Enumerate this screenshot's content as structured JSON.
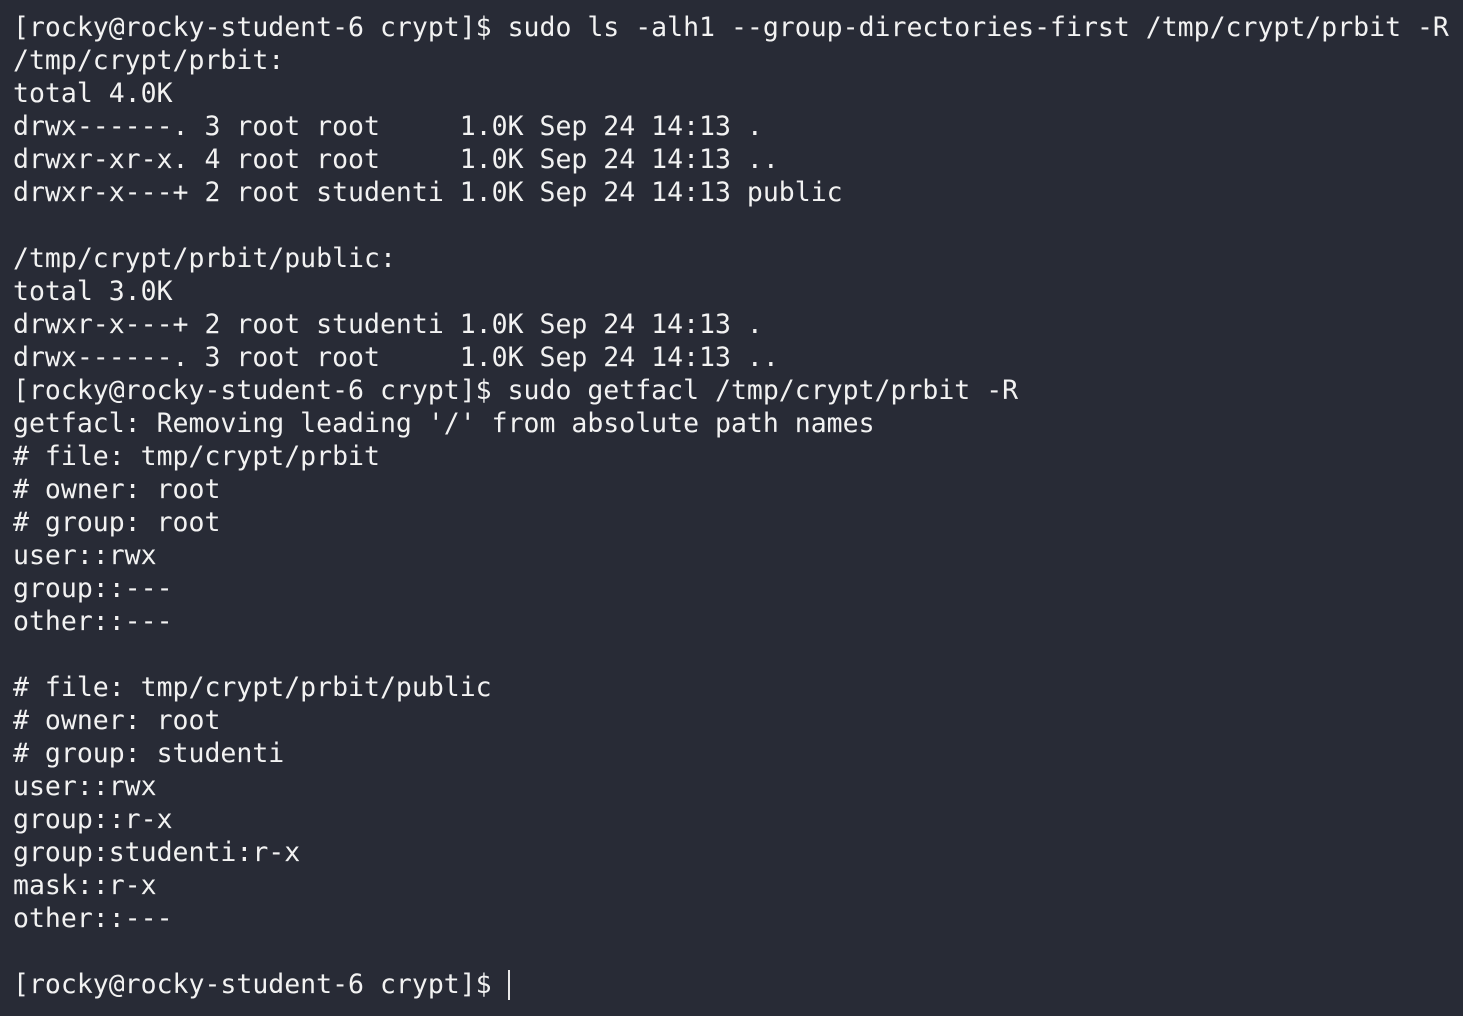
{
  "terminal": {
    "lines": [
      "[rocky@rocky-student-6 crypt]$ sudo ls -alh1 --group-directories-first /tmp/crypt/prbit -R",
      "/tmp/crypt/prbit:",
      "total 4.0K",
      "drwx------. 3 root root     1.0K Sep 24 14:13 .",
      "drwxr-xr-x. 4 root root     1.0K Sep 24 14:13 ..",
      "drwxr-x---+ 2 root studenti 1.0K Sep 24 14:13 public",
      "",
      "/tmp/crypt/prbit/public:",
      "total 3.0K",
      "drwxr-x---+ 2 root studenti 1.0K Sep 24 14:13 .",
      "drwx------. 3 root root     1.0K Sep 24 14:13 ..",
      "[rocky@rocky-student-6 crypt]$ sudo getfacl /tmp/crypt/prbit -R",
      "getfacl: Removing leading '/' from absolute path names",
      "# file: tmp/crypt/prbit",
      "# owner: root",
      "# group: root",
      "user::rwx",
      "group::---",
      "other::---",
      "",
      "# file: tmp/crypt/prbit/public",
      "# owner: root",
      "# group: studenti",
      "user::rwx",
      "group::r-x",
      "group:studenti:r-x",
      "mask::r-x",
      "other::---",
      ""
    ],
    "prompt": "[rocky@rocky-student-6 crypt]$"
  },
  "colors": {
    "background": "#282b36",
    "foreground": "#f2f2f2"
  }
}
